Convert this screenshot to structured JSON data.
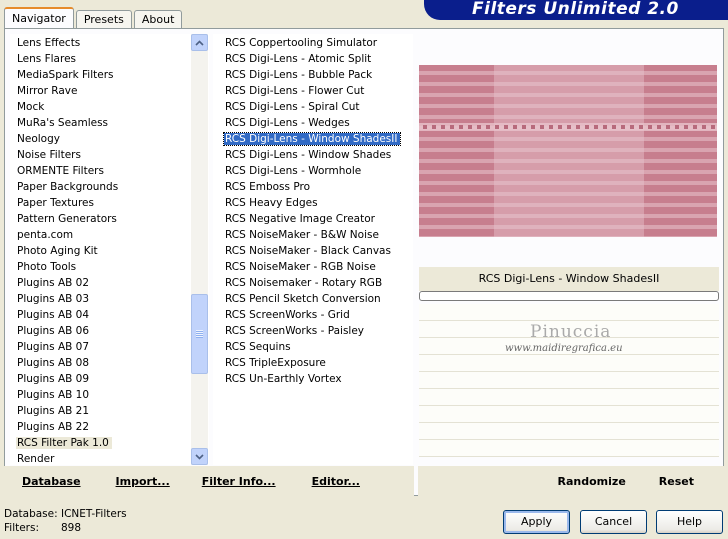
{
  "tabs": [
    "Navigator",
    "Presets",
    "About"
  ],
  "brand": "Filters Unlimited 2.0",
  "categories": [
    {
      "label": "Lens Effects"
    },
    {
      "label": "Lens Flares"
    },
    {
      "label": "MediaSpark Filters"
    },
    {
      "label": "Mirror Rave"
    },
    {
      "label": "Mock"
    },
    {
      "label": "MuRa's Seamless"
    },
    {
      "label": "Neology"
    },
    {
      "label": "Noise Filters"
    },
    {
      "label": "ORMENTE Filters"
    },
    {
      "label": "Paper Backgrounds"
    },
    {
      "label": "Paper Textures"
    },
    {
      "label": "Pattern Generators"
    },
    {
      "label": "penta.com"
    },
    {
      "label": "Photo Aging Kit"
    },
    {
      "label": "Photo Tools"
    },
    {
      "label": "Plugins AB 02"
    },
    {
      "label": "Plugins AB 03"
    },
    {
      "label": "Plugins AB 04"
    },
    {
      "label": "Plugins AB 06"
    },
    {
      "label": "Plugins AB 07"
    },
    {
      "label": "Plugins AB 08"
    },
    {
      "label": "Plugins AB 09"
    },
    {
      "label": "Plugins AB 10"
    },
    {
      "label": "Plugins AB 21"
    },
    {
      "label": "Plugins AB 22"
    },
    {
      "label": "RCS Filter Pak 1.0",
      "current": true
    },
    {
      "label": "Render"
    }
  ],
  "filters": [
    {
      "label": "RCS Coppertooling Simulator"
    },
    {
      "label": "RCS Digi-Lens - Atomic Split"
    },
    {
      "label": "RCS Digi-Lens - Bubble Pack"
    },
    {
      "label": "RCS Digi-Lens - Flower Cut"
    },
    {
      "label": "RCS Digi-Lens - Spiral Cut"
    },
    {
      "label": "RCS Digi-Lens - Wedges"
    },
    {
      "label": "RCS Digi-Lens - Window ShadesII",
      "selected": true
    },
    {
      "label": "RCS Digi-Lens - Window Shades"
    },
    {
      "label": "RCS Digi-Lens - Wormhole"
    },
    {
      "label": "RCS Emboss Pro"
    },
    {
      "label": "RCS Heavy Edges"
    },
    {
      "label": "RCS Negative Image Creator"
    },
    {
      "label": "RCS NoiseMaker - B&W Noise"
    },
    {
      "label": "RCS NoiseMaker - Black Canvas"
    },
    {
      "label": "RCS NoiseMaker - RGB Noise"
    },
    {
      "label": "RCS Noisemaker - Rotary RGB"
    },
    {
      "label": "RCS Pencil Sketch Conversion"
    },
    {
      "label": "RCS ScreenWorks - Grid"
    },
    {
      "label": "RCS ScreenWorks - Paisley"
    },
    {
      "label": "RCS Sequins"
    },
    {
      "label": "RCS TripleExposure"
    },
    {
      "label": "RCS Un-Earthly Vortex"
    }
  ],
  "preview": {
    "filter_name": "RCS Digi-Lens - Window ShadesII",
    "colors": {
      "base": "#c77e8e",
      "light": "#e8c3cc",
      "dark": "#b86a7c"
    }
  },
  "watermark": {
    "name": "Pinuccia",
    "site": "www.maidiregrafica.eu"
  },
  "toolbar_left": [
    "Database",
    "Import...",
    "Filter Info...",
    "Editor..."
  ],
  "toolbar_right": [
    "Randomize",
    "Reset"
  ],
  "status": {
    "database_label": "Database:",
    "database_value": "ICNET-Filters",
    "filters_label": "Filters:",
    "filters_value": "898"
  },
  "buttons": {
    "apply": "Apply",
    "cancel": "Cancel",
    "help": "Help"
  }
}
